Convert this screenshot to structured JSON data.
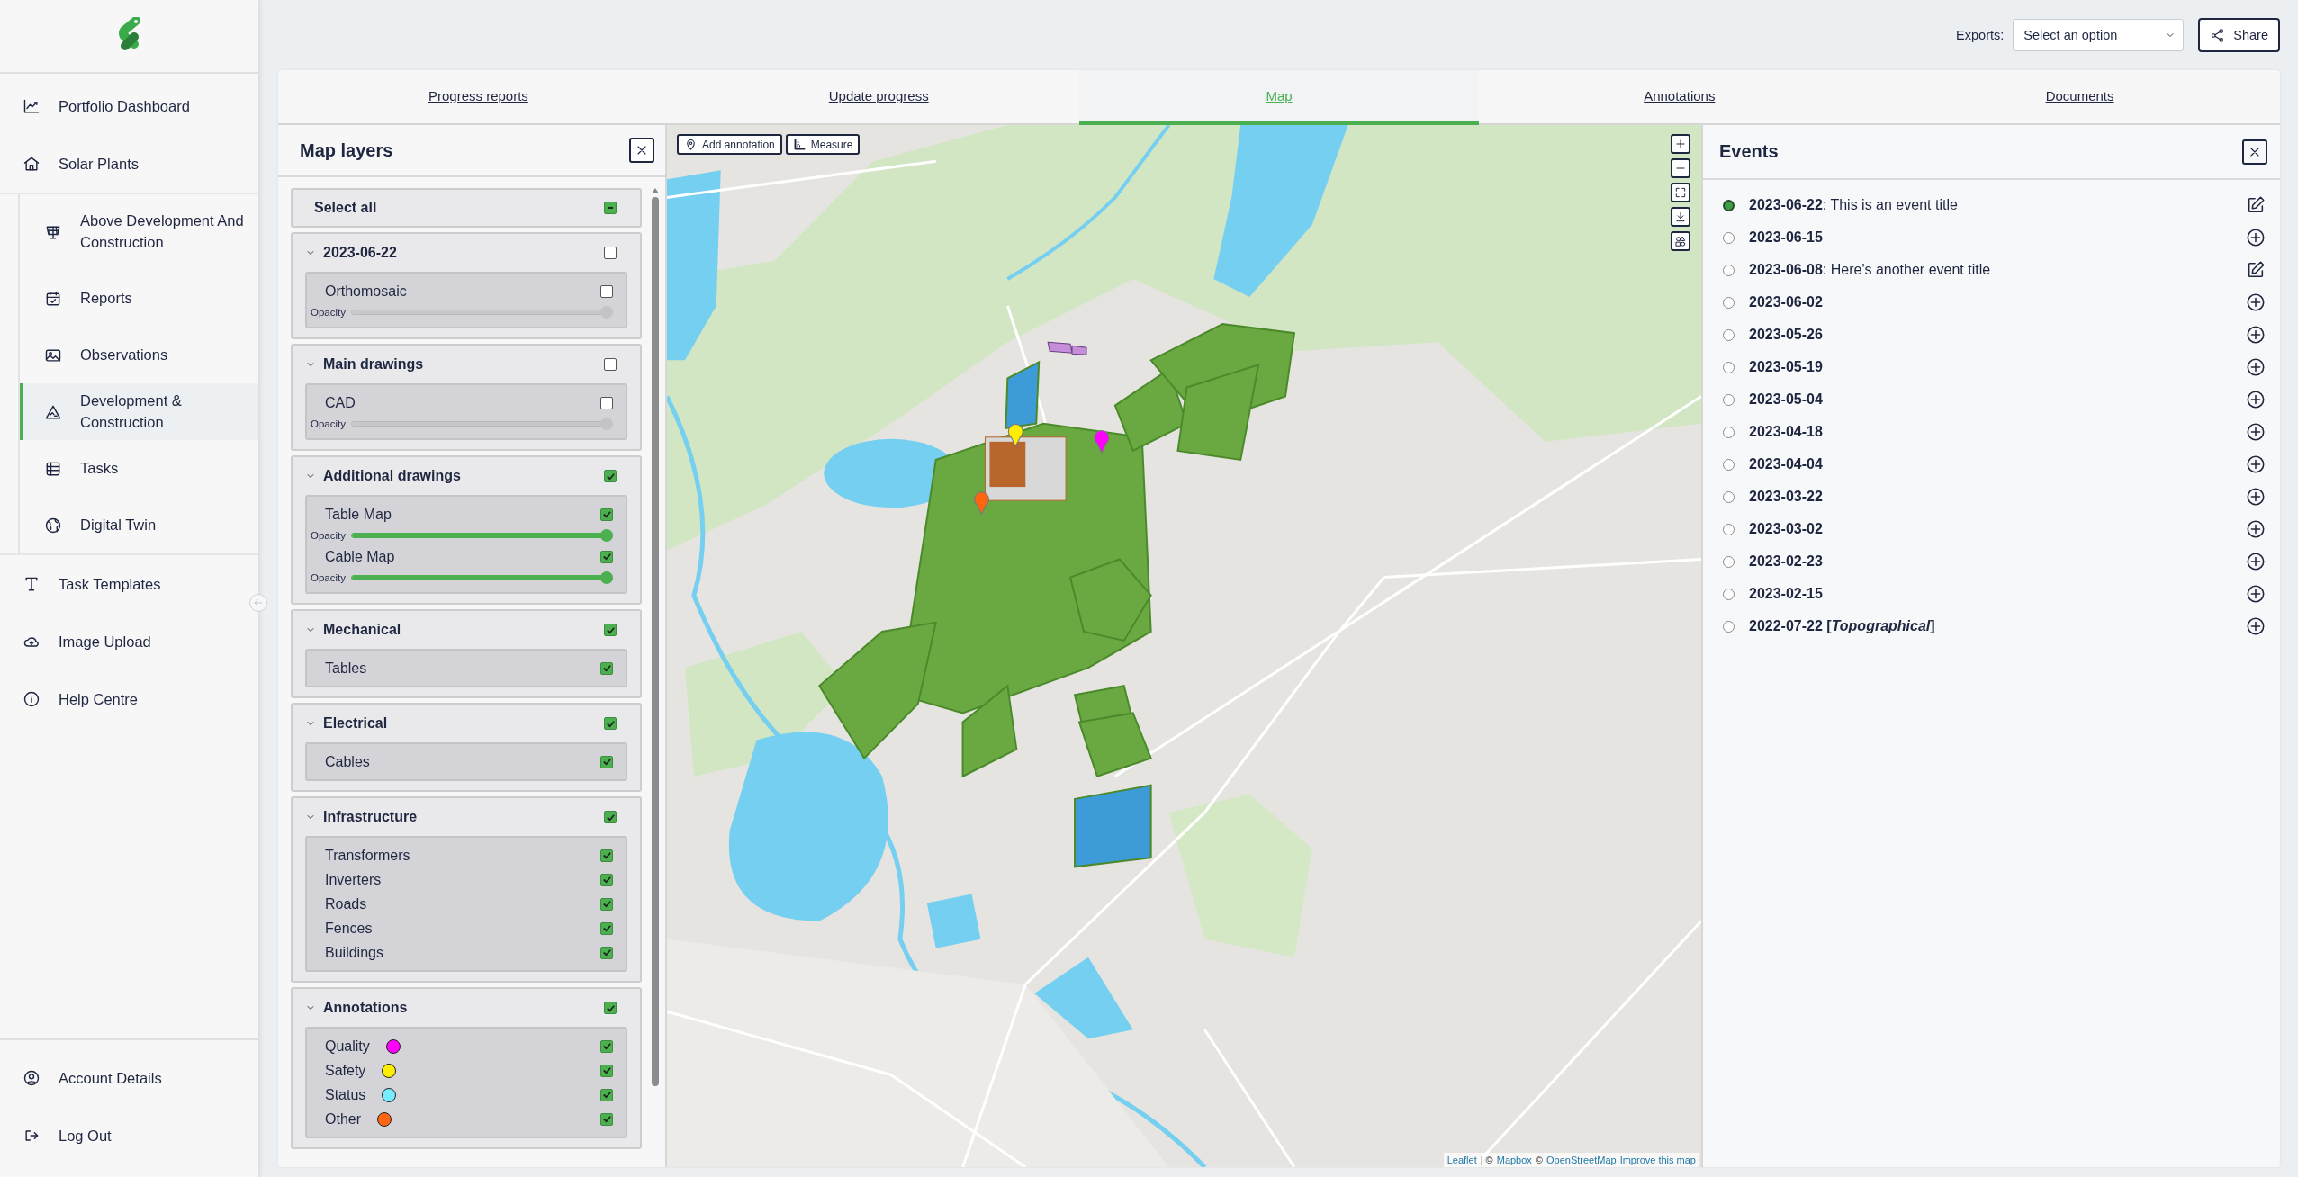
{
  "sidebar": {
    "items": [
      {
        "label": "Portfolio Dashboard",
        "selected": false
      },
      {
        "label": "Solar Plants",
        "selected": false,
        "expanded": true,
        "children": [
          {
            "label": "Above Development And Construction",
            "selected": false
          },
          {
            "label": "Reports",
            "selected": false
          },
          {
            "label": "Observations",
            "selected": false
          },
          {
            "label": "Development & Construction",
            "selected": true
          },
          {
            "label": "Tasks",
            "selected": false
          },
          {
            "label": "Digital Twin",
            "selected": false
          }
        ]
      },
      {
        "label": "Task Templates",
        "selected": false
      },
      {
        "label": "Image Upload",
        "selected": false
      },
      {
        "label": "Help Centre",
        "selected": false
      }
    ],
    "account_items": [
      {
        "label": "Account Details",
        "selected": false
      },
      {
        "label": "Log Out",
        "selected": false
      }
    ]
  },
  "toolbar": {
    "exports_label": "Exports:",
    "exports_value": "Select an option",
    "share_button": "Share"
  },
  "tabs": [
    {
      "label": "Progress reports",
      "selected": false
    },
    {
      "label": "Update progress",
      "selected": false
    },
    {
      "label": "Map",
      "selected": true
    },
    {
      "label": "Annotations",
      "selected": false
    },
    {
      "label": "Documents",
      "selected": false
    }
  ],
  "layers_panel": {
    "title": "Map layers",
    "select_all": {
      "label": "Select all",
      "indeterminate": true
    },
    "groups": [
      {
        "label": "2023-06-22",
        "expanded": true,
        "checked": false,
        "layers": [
          {
            "label": "Orthomosaic",
            "checked": false,
            "opacity": {
              "label": "Opacity",
              "level": 1
            }
          }
        ]
      },
      {
        "label": "Main drawings",
        "expanded": true,
        "checked": false,
        "layers": [
          {
            "label": "CAD",
            "checked": false,
            "opacity": {
              "label": "Opacity",
              "level": 1
            }
          }
        ]
      },
      {
        "label": "Additional drawings",
        "expanded": true,
        "checked": true,
        "layers": [
          {
            "label": "Table Map",
            "checked": true,
            "opacity": {
              "label": "Opacity",
              "level": 1
            }
          },
          {
            "label": "Cable Map",
            "checked": true,
            "opacity": {
              "label": "Opacity",
              "level": 1
            }
          }
        ]
      },
      {
        "label": "Mechanical",
        "expanded": true,
        "checked": true,
        "layers": [
          {
            "label": "Tables",
            "checked": true
          }
        ]
      },
      {
        "label": "Electrical",
        "expanded": true,
        "checked": true,
        "layers": [
          {
            "label": "Cables",
            "checked": true
          }
        ]
      },
      {
        "label": "Infrastructure",
        "expanded": true,
        "checked": true,
        "layers": [
          {
            "label": "Transformers",
            "checked": true
          },
          {
            "label": "Inverters",
            "checked": true
          },
          {
            "label": "Roads",
            "checked": true
          },
          {
            "label": "Fences",
            "checked": true
          },
          {
            "label": "Buildings",
            "checked": true
          }
        ]
      },
      {
        "label": "Annotations",
        "expanded": true,
        "checked": true,
        "layers": [
          {
            "label": "Quality",
            "checked": true,
            "color": "#ff00ff"
          },
          {
            "label": "Safety",
            "checked": true,
            "color": "#ffee00"
          },
          {
            "label": "Status",
            "checked": true,
            "color": "#77eeff"
          },
          {
            "label": "Other",
            "checked": true,
            "color": "#ff6611"
          }
        ]
      }
    ]
  },
  "map": {
    "buttons": [
      "Add annotation",
      "Measure"
    ],
    "attribution": [
      {
        "text": "Leaflet",
        "kind": "link"
      },
      {
        "text": "| ©",
        "kind": "text"
      },
      {
        "text": "Mapbox",
        "kind": "link"
      },
      {
        "text": "©",
        "kind": "text"
      },
      {
        "text": "OpenStreetMap",
        "kind": "link"
      },
      {
        "text": "Improve this map",
        "kind": "link"
      }
    ]
  },
  "events_panel": {
    "title": "Events",
    "items": [
      {
        "label": "**2023-06-22**: This is an event title",
        "kind": "titled",
        "selected": true
      },
      {
        "label": "2023-06-15",
        "kind": "untitled",
        "selected": false
      },
      {
        "label": "**2023-06-08**: Here's another event title",
        "kind": "titled",
        "selected": false
      },
      {
        "label": "2023-06-02",
        "kind": "untitled",
        "selected": false
      },
      {
        "label": "2023-05-26",
        "kind": "untitled",
        "selected": false
      },
      {
        "label": "2023-05-19",
        "kind": "untitled",
        "selected": false
      },
      {
        "label": "2023-05-04",
        "kind": "untitled",
        "selected": false
      },
      {
        "label": "2023-04-18",
        "kind": "untitled",
        "selected": false
      },
      {
        "label": "2023-04-04",
        "kind": "untitled",
        "selected": false
      },
      {
        "label": "2023-03-22",
        "kind": "untitled",
        "selected": false
      },
      {
        "label": "2023-03-02",
        "kind": "untitled",
        "selected": false
      },
      {
        "label": "2023-02-23",
        "kind": "untitled",
        "selected": false
      },
      {
        "label": "2023-02-15",
        "kind": "untitled",
        "selected": false
      },
      {
        "label": "2022-07-22 [*Topographical*]",
        "kind": "untitled",
        "selected": false
      }
    ]
  }
}
